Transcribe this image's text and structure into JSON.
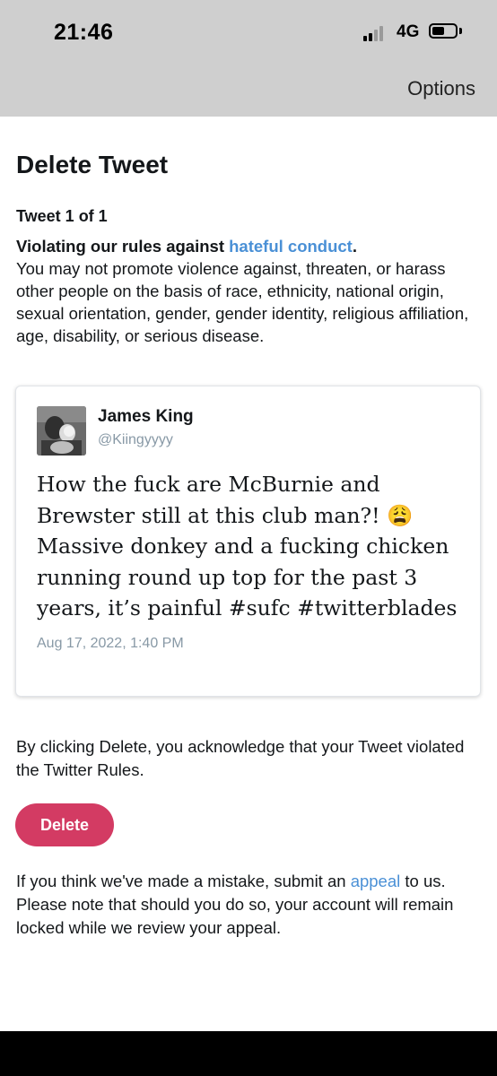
{
  "status_bar": {
    "time": "21:46",
    "network": "4G"
  },
  "nav": {
    "options_label": "Options"
  },
  "page": {
    "title": "Delete Tweet",
    "tweet_count": "Tweet 1 of 1",
    "violation_prefix": "Violating our rules against ",
    "violation_link": "hateful conduct",
    "violation_suffix": ".",
    "violation_description": "You may not promote violence against, threaten, or harass other people on the basis of race, ethnicity, national origin, sexual orientation, gender, gender identity, religious affiliation, age, disability, or serious disease."
  },
  "tweet": {
    "author_name": "James King",
    "author_handle": "@Kiingyyyy",
    "text": "How the fuck are McBurnie and Brewster still at this club man?! 😩 Massive donkey and a fucking chicken running round up top for the past 3 years, it’s painful #sufc #twitterblades",
    "date": "Aug 17, 2022, 1:40 PM"
  },
  "acknowledgement": "By clicking Delete, you acknowledge that your Tweet violated the Twitter Rules.",
  "delete_label": "Delete",
  "appeal": {
    "prefix": "If you think we've made a mistake, submit an ",
    "link": "appeal",
    "suffix": " to us. Please note that should you do so, your account will remain locked while we review your appeal."
  },
  "colors": {
    "accent_link": "#4a90d6",
    "delete_button": "#d33b63",
    "header_background": "#cfcfcf"
  },
  "icons": [
    "signal-icon",
    "battery-icon",
    "avatar-image"
  ]
}
